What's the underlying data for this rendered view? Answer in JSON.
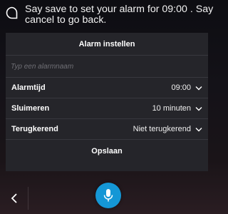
{
  "prompt": {
    "text_line1": "Say save to set your alarm for 09:00 . Say",
    "text_line2": "cancel to go back."
  },
  "alarm": {
    "title": "Alarm instellen",
    "name_placeholder": "Typ een alarmnaam",
    "rows": [
      {
        "label": "Alarmtijd",
        "value": "09:00"
      },
      {
        "label": "Sluimeren",
        "value": "10 minuten"
      },
      {
        "label": "Terugkerend",
        "value": "Niet terugkerend"
      }
    ],
    "save_label": "Opslaan"
  },
  "icons": {
    "assistant": "assistant-bubble-icon",
    "dropdown": "chevron-down-icon",
    "back": "chevron-left-icon",
    "mic": "microphone-icon"
  },
  "colors": {
    "accent": "#1597d6",
    "card": "#25252a"
  }
}
